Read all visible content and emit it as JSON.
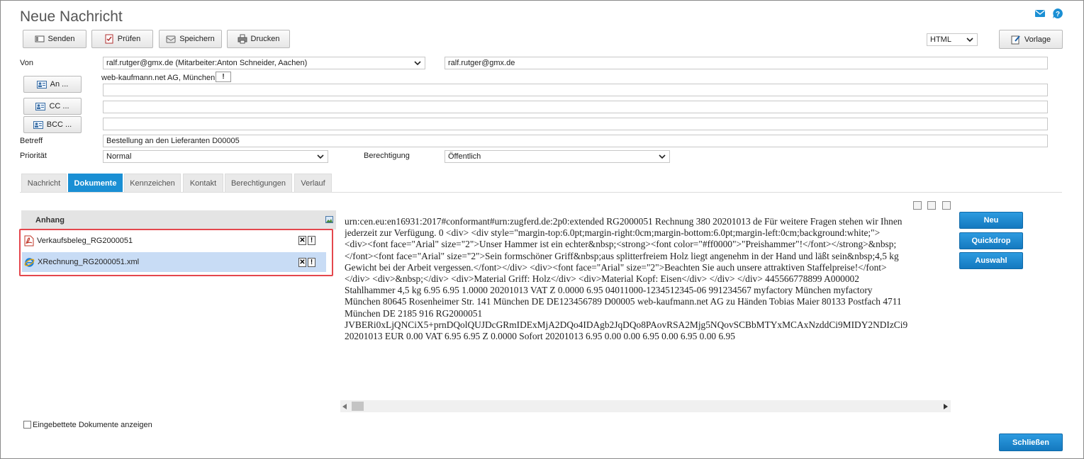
{
  "window": {
    "title": "Neue Nachricht"
  },
  "toolbar": {
    "send": "Senden",
    "check": "Prüfen",
    "save": "Speichern",
    "print": "Drucken",
    "format": "HTML",
    "template": "Vorlage"
  },
  "form": {
    "from_label": "Von",
    "from_select": "ralf.rutger@gmx.de (Mitarbeiter:Anton Schneider, Aachen)",
    "from_address": "ralf.rutger@gmx.de",
    "company": "web-kaufmann.net AG, München",
    "to_button": "An ...",
    "cc_button": "CC ...",
    "bcc_button": "BCC ...",
    "to_value": "",
    "cc_value": "",
    "bcc_value": "",
    "subject_label": "Betreff",
    "subject_value": "Bestellung an den Lieferanten D00005",
    "priority_label": "Priorität",
    "priority_value": "Normal",
    "permission_label": "Berechtigung",
    "permission_value": "Öffentlich"
  },
  "tabs": [
    {
      "label": "Nachricht",
      "active": false
    },
    {
      "label": "Dokumente",
      "active": true
    },
    {
      "label": "Kennzeichen",
      "active": false
    },
    {
      "label": "Kontakt",
      "active": false
    },
    {
      "label": "Berechtigungen",
      "active": false
    },
    {
      "label": "Verlauf",
      "active": false
    }
  ],
  "attachments": {
    "header": "Anhang",
    "items": [
      {
        "name": "Verkaufsbeleg_RG2000051",
        "icon": "pdf-icon",
        "selected": false
      },
      {
        "name": "XRechnung_RG2000051.xml",
        "icon": "internet-explorer-icon",
        "selected": true
      }
    ]
  },
  "preview": {
    "lines": [
      "urn:cen.eu:en16931:2017#conformant#urn:zugferd.de:2p0:extended RG2000051 Rechnung 380 20201013 de Für weitere Fragen stehen wir Ihnen",
      "jederzeit zur Verfügung. 0 <div> <div style=\"margin-top:6.0pt;margin-right:0cm;margin-bottom:6.0pt;margin-left:0cm;background:white;\">",
      "<div><font face=\"Arial\" size=\"2\">Unser Hammer ist ein echter&nbsp;<strong><font color=\"#ff0000\">\"Preishammer\"!</font></strong>&nbsp;",
      "</font><font face=\"Arial\" size=\"2\">Sein formschöner Griff&nbsp;aus splitterfreiem Holz liegt angenehm in der Hand und läßt sein&nbsp;4,5 kg",
      "Gewicht bei der Arbeit vergessen.</font></div> <div><font face=\"Arial\" size=\"2\">Beachten Sie auch unsere attraktiven Staffelpreise!</font>",
      "</div> <div>&nbsp;</div> <div>Material Griff: Holz</div> <div>Material Kopf: Eisen</div> </div> </div> 445566778899 A000002",
      "Stahlhammer 4,5 kg 6.95 6.95 1.0000 20201013 VAT Z 0.0000 6.95 04011000-1234512345-06 991234567 myfactory München myfactory",
      "München 80645 Rosenheimer Str. 141 München DE DE123456789 D00005 web-kaufmann.net AG zu Händen Tobias Maier 80133 Postfach 4711",
      "München DE 2185 916 RG2000051",
      "JVBERi0xLjQNCiX5+prnDQolQUJDcGRmIDExMjA2DQo4IDAgb2JqDQo8PAovRSA2Mjg5NQovSCBbMTYxMCAxNzddCi9MIDY2NDIzCi9",
      "20201013 EUR 0.00 VAT 6.95 6.95 Z 0.0000 Sofort 20201013 6.95 0.00 0.00 6.95 0.00 6.95 0.00 6.95"
    ]
  },
  "side_buttons": {
    "new": "Neu",
    "quickdrop": "Quickdrop",
    "select": "Auswahl"
  },
  "footer": {
    "embedded_label": "Eingebettete Dokumente anzeigen",
    "close": "Schließen"
  },
  "colors": {
    "accent": "#1a8fd4",
    "highlight": "#e4474d",
    "selection": "#c8dcf5"
  }
}
